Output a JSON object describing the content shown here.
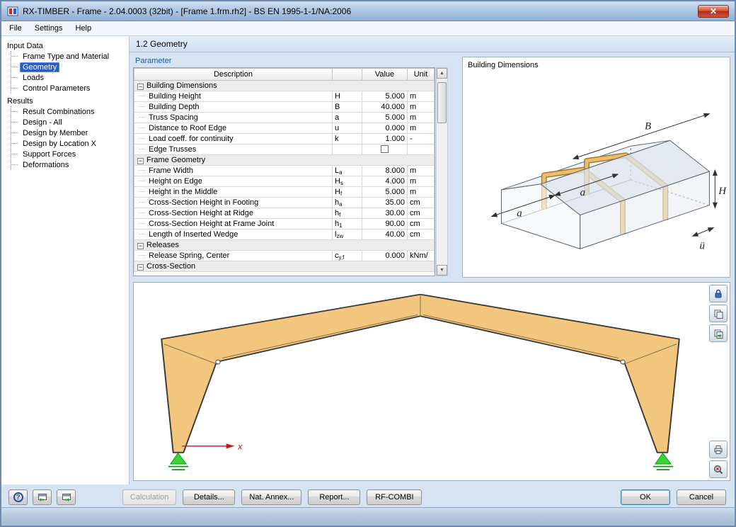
{
  "window": {
    "title": "RX-TIMBER - Frame - 2.04.0003 (32bit) - [Frame 1.frm.rh2] - BS EN 1995-1-1/NA:2006",
    "close_glyph": "✕"
  },
  "menu": {
    "file": "File",
    "settings": "Settings",
    "help": "Help"
  },
  "sidebar": {
    "tree": [
      {
        "label": "Input Data",
        "children": [
          {
            "label": "Frame Type and Material"
          },
          {
            "label": "Geometry",
            "selected": true
          },
          {
            "label": "Loads"
          },
          {
            "label": "Control Parameters"
          }
        ]
      },
      {
        "label": "Results",
        "children": [
          {
            "label": "Result Combinations"
          },
          {
            "label": "Design - All"
          },
          {
            "label": "Design by Member"
          },
          {
            "label": "Design by Location X"
          },
          {
            "label": "Support Forces"
          },
          {
            "label": "Deformations"
          }
        ]
      }
    ]
  },
  "page": {
    "header": "1.2 Geometry"
  },
  "parameters": {
    "panel_label": "Parameter",
    "columns": {
      "description": "Description",
      "symbol": "",
      "value": "Value",
      "unit": "Unit"
    },
    "rows": [
      {
        "type": "group",
        "label": "Building Dimensions"
      },
      {
        "type": "item",
        "description": "Building Height",
        "symbol": "H",
        "sub": "",
        "value": "5.000",
        "unit": "m"
      },
      {
        "type": "item",
        "description": "Building Depth",
        "symbol": "B",
        "sub": "",
        "value": "40.000",
        "unit": "m"
      },
      {
        "type": "item",
        "description": "Truss Spacing",
        "symbol": "a",
        "sub": "",
        "value": "5.000",
        "unit": "m"
      },
      {
        "type": "item",
        "description": "Distance to Roof Edge",
        "symbol": "u",
        "sub": "",
        "value": "0.000",
        "unit": "m"
      },
      {
        "type": "item",
        "description": "Load coeff. for continuity",
        "symbol": "k",
        "sub": "",
        "value": "1.000",
        "unit": "-"
      },
      {
        "type": "checkbox",
        "description": "Edge Trusses",
        "symbol": "",
        "sub": "",
        "checked": false,
        "unit": ""
      },
      {
        "type": "group",
        "label": "Frame Geometry"
      },
      {
        "type": "item",
        "description": "Frame Width",
        "symbol": "L",
        "sub": "a",
        "value": "8.000",
        "unit": "m"
      },
      {
        "type": "item",
        "description": "Height on Edge",
        "symbol": "H",
        "sub": "s",
        "value": "4.000",
        "unit": "m"
      },
      {
        "type": "item",
        "description": "Height in the Middle",
        "symbol": "H",
        "sub": "f",
        "value": "5.000",
        "unit": "m"
      },
      {
        "type": "item",
        "description": "Cross-Section Height in Footing",
        "symbol": "h",
        "sub": "a",
        "value": "35.00",
        "unit": "cm"
      },
      {
        "type": "item",
        "description": "Cross-Section Height at Ridge",
        "symbol": "h",
        "sub": "f",
        "value": "30.00",
        "unit": "cm"
      },
      {
        "type": "item",
        "description": "Cross-Section Height at Frame Joint",
        "symbol": "h",
        "sub": "1",
        "value": "90.00",
        "unit": "cm"
      },
      {
        "type": "item",
        "description": "Length of Inserted Wedge",
        "symbol": "l",
        "sub": "zw",
        "value": "40.00",
        "unit": "cm"
      },
      {
        "type": "group",
        "label": "Releases"
      },
      {
        "type": "item",
        "description": "Release Spring, Center",
        "symbol": "c",
        "sub": "y,f",
        "value": "0.000",
        "unit": "kNm/"
      },
      {
        "type": "group",
        "label": "Cross-Section"
      }
    ]
  },
  "building_view": {
    "title": "Building Dimensions",
    "dim_labels": {
      "B": "B",
      "H": "H",
      "a1": "a",
      "a2": "a",
      "u": "ü"
    }
  },
  "frame_view": {
    "axis_label": "x"
  },
  "footer": {
    "help": "?",
    "calculation": "Calculation",
    "details": "Details...",
    "nat_annex": "Nat. Annex...",
    "report": "Report...",
    "rf_combi": "RF-COMBI",
    "ok": "OK",
    "cancel": "Cancel"
  },
  "icons": {
    "collapse": "−",
    "scroll_up": "▲",
    "scroll_down": "▼"
  }
}
